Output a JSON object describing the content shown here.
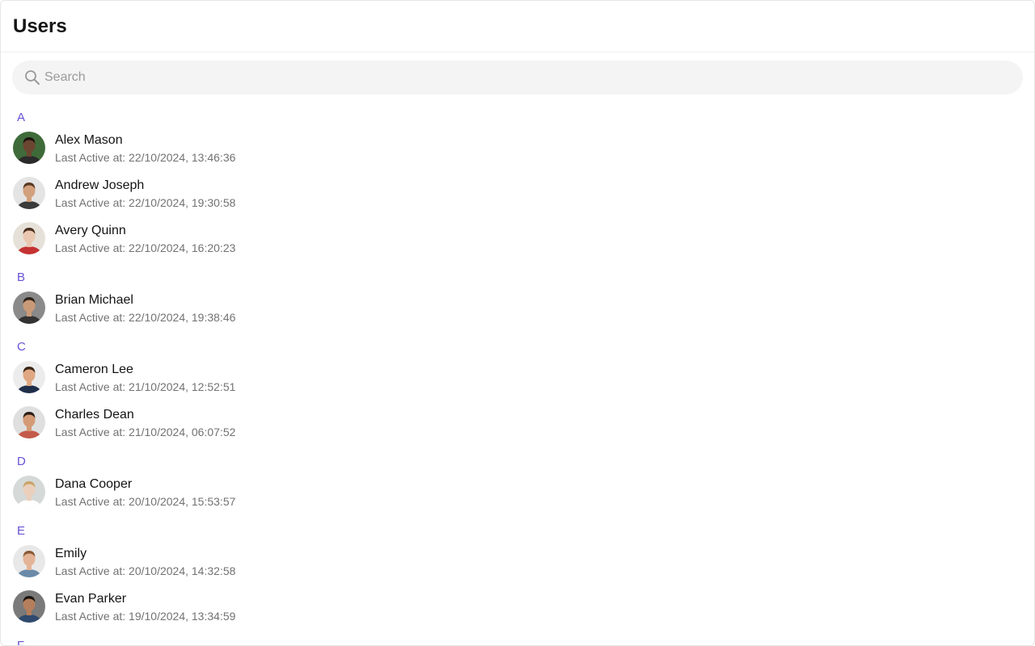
{
  "header": {
    "title": "Users"
  },
  "search": {
    "placeholder": "Search",
    "value": ""
  },
  "colors": {
    "accent": "#6852d6",
    "title_text": "#141414",
    "secondary_text": "#727272",
    "search_bg": "#f4f4f4"
  },
  "sections": [
    {
      "letter": "A",
      "users": [
        {
          "name": "Alex Mason",
          "status": "Last Active at: 22/10/2024, 13:46:36",
          "avatar": {
            "bg": "#3f6b3a",
            "skin": "#6b4630",
            "hair": "#1c1410",
            "shirt": "#2a2a2a"
          }
        },
        {
          "name": "Andrew Joseph",
          "status": "Last Active at: 22/10/2024, 19:30:58",
          "avatar": {
            "bg": "#e4e4e4",
            "skin": "#d2a07c",
            "hair": "#5a3a22",
            "shirt": "#3b3b3b"
          }
        },
        {
          "name": "Avery Quinn",
          "status": "Last Active at: 22/10/2024, 16:20:23",
          "avatar": {
            "bg": "#e6e1d8",
            "skin": "#e9c7b0",
            "hair": "#4a2e1e",
            "shirt": "#c43232"
          }
        }
      ]
    },
    {
      "letter": "B",
      "users": [
        {
          "name": "Brian Michael",
          "status": "Last Active at: 22/10/2024, 19:38:46",
          "avatar": {
            "bg": "#8a8a8a",
            "skin": "#c99a78",
            "hair": "#2c2018",
            "shirt": "#333333"
          }
        }
      ]
    },
    {
      "letter": "C",
      "users": [
        {
          "name": "Cameron Lee",
          "status": "Last Active at: 21/10/2024, 12:52:51",
          "avatar": {
            "bg": "#ececec",
            "skin": "#e0a882",
            "hair": "#3a2618",
            "shirt": "#1f2e4a"
          }
        },
        {
          "name": "Charles Dean",
          "status": "Last Active at: 21/10/2024, 06:07:52",
          "avatar": {
            "bg": "#dfdfdf",
            "skin": "#d49a74",
            "hair": "#2a1e16",
            "shirt": "#c45a4a"
          }
        }
      ]
    },
    {
      "letter": "D",
      "users": [
        {
          "name": "Dana Cooper",
          "status": "Last Active at: 20/10/2024, 15:53:57",
          "avatar": {
            "bg": "#d5d9d8",
            "skin": "#ead0bc",
            "hair": "#c9a46a",
            "shirt": "#ffffff"
          }
        }
      ]
    },
    {
      "letter": "E",
      "users": [
        {
          "name": "Emily",
          "status": "Last Active at: 20/10/2024, 14:32:58",
          "avatar": {
            "bg": "#e8e8e8",
            "skin": "#e3b497",
            "hair": "#8a5a36",
            "shirt": "#6a8aa8"
          }
        },
        {
          "name": "Evan Parker",
          "status": "Last Active at: 19/10/2024, 13:34:59",
          "avatar": {
            "bg": "#7a7a7a",
            "skin": "#b57e5c",
            "hair": "#1a1410",
            "shirt": "#2f4a6e"
          }
        }
      ]
    },
    {
      "letter": "F",
      "users": []
    }
  ]
}
